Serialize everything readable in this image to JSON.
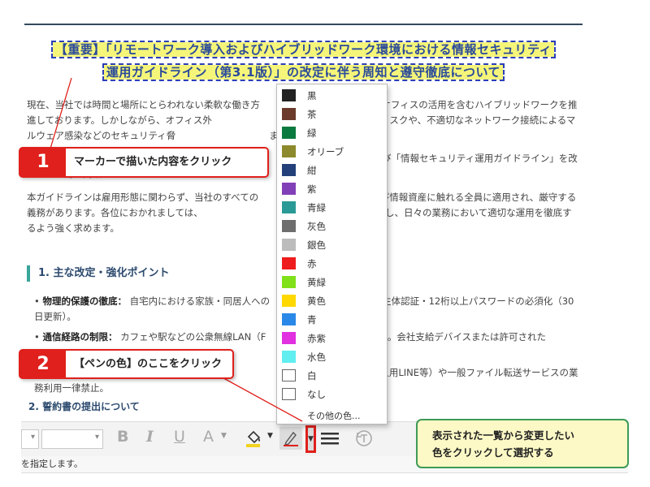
{
  "document": {
    "title_line1": "【重要】「リモートワーク導入およびハイブリッドワーク環境における情報セキュリティ",
    "title_line2": "運用ガイドライン（第3.1版）」の改定に伴う周知と遵守徹底について",
    "para1": "現在、当社では時間と場所にとらわれない柔軟な働き方　　　　　　　　　　ライトオフィスの活用を含むハイブリッドワークを推進しております。しかしながら、オフィス外　　　　　　　　　　　い、紛失・盗難リスクや、不適切なネットワーク接続によるマルウェア感染などのセキュリティ脅　　　　　　　　　　ます。",
    "para2": "　　　　　　　　　　　　　　　　　　　　　　安　　　　　　　　　ため、このたび「情報セキュリティ運用ガイドライン」を改定し、運用を開始いたします。",
    "para3": "本ガイドラインは雇用形態に関わらず、当社のすべての　　　　　　　　　　、および情報資産に触れる全員に適用され、厳守する義務があります。各位におかれましては、　　　　　　　　　ガイドラインを必ず熟読し、日々の業務において適切な運用を徹底するよう強く求めます。",
    "section_heading": "1. 主な改定・強化ポイント",
    "bullet1_label": "物理的保護の徹底：",
    "bullet1_text": "自宅内における家族・同居人への　　　　　　　　　　よび生体認証・12桁以上パスワードの必須化（30日更新）。",
    "bullet2_label": "通信経路の制限：",
    "bullet2_text": "カフェや駅などの公衆無線LAN（F　　　　　　　　　　面禁止。会社支給デバイスまたは許可された",
    "bullet3_text": "　　　　　　　　　　　　　　　　ト提供し　　　　　　　　　ネスチャット（個人用LINE等）や一般ファイル転送サービスの業務利用一律禁止。",
    "sub3": "2. 誓約書の提出について"
  },
  "toolbar": {
    "bold": "B",
    "italic": "I",
    "underline": "U",
    "font_color": "A",
    "pen_arrow": "▼",
    "select_arrow": "▾"
  },
  "statusbar": {
    "text": "を指定します。"
  },
  "color_menu": {
    "items": [
      {
        "label": "黒",
        "color": "#222222"
      },
      {
        "label": "茶",
        "color": "#6b3a2a"
      },
      {
        "label": "緑",
        "color": "#0a7a3e"
      },
      {
        "label": "オリーブ",
        "color": "#8c8a2c"
      },
      {
        "label": "紺",
        "color": "#23407a"
      },
      {
        "label": "紫",
        "color": "#8240b8"
      },
      {
        "label": "青緑",
        "color": "#2a9a96"
      },
      {
        "label": "灰色",
        "color": "#6e6e6e"
      },
      {
        "label": "銀色",
        "color": "#bcbcbc"
      },
      {
        "label": "赤",
        "color": "#ee1c1c"
      },
      {
        "label": "黄緑",
        "color": "#80e01a"
      },
      {
        "label": "黄色",
        "color": "#ffd800"
      },
      {
        "label": "青",
        "color": "#2a88e8"
      },
      {
        "label": "赤紫",
        "color": "#e030e0"
      },
      {
        "label": "水色",
        "color": "#60eef0"
      },
      {
        "label": "白",
        "color": "#ffffff"
      },
      {
        "label": "なし",
        "color": "#ffffff"
      }
    ],
    "more": "その他の色..."
  },
  "callouts": {
    "step1_num": "1",
    "step1_text": "マーカーで描いた内容をクリック",
    "step2_num": "2",
    "step2_text": "【ペンの色】のここをクリック",
    "note_line1": "表示された一覧から変更したい",
    "note_line2": "色をクリックして選択する"
  },
  "colors": {
    "accent": "#e0201c",
    "note_border": "#3f9a56",
    "marker": "#f5f57a"
  }
}
